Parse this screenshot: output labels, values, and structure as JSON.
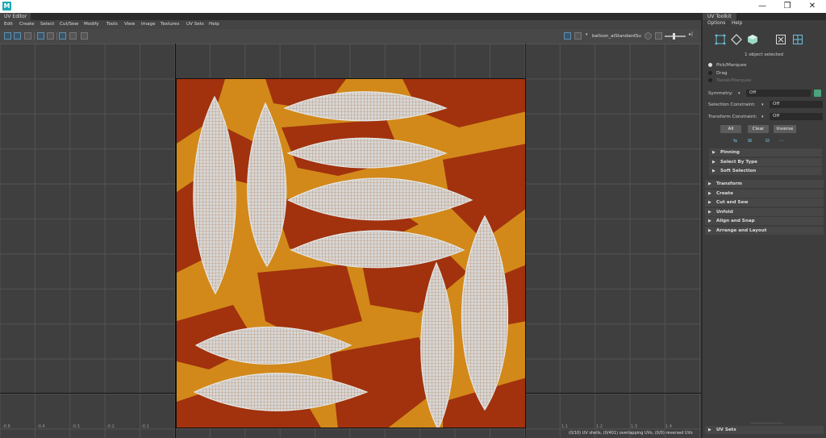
{
  "app": {
    "logo_letter": "M"
  },
  "window_controls": {
    "minimize": "—",
    "restore": "❐",
    "close": "✕"
  },
  "editor": {
    "tab_title": "UV Editor",
    "menus": [
      "Edit",
      "Create",
      "Select",
      "Cut/Sew",
      "Modify",
      "Tools",
      "View",
      "Image",
      "Textures",
      "UV Sets",
      "Help"
    ],
    "texture_name": "balloon_aiStandardSu",
    "axis_labels": [
      "-0.6",
      "-0.4",
      "-0.3",
      "-0.2",
      "-0.1",
      "1.1",
      "1.2",
      "1.3",
      "1.4"
    ],
    "status_text": "(0/10) UV shells, (0/401) overlapping UVs, (0/0) reversed UVs"
  },
  "toolkit": {
    "tab_title": "UV Toolkit",
    "menus": [
      "Options",
      "Help"
    ],
    "selection_count": "1 object selected",
    "selection_modes": [
      {
        "label": "Pick/Marquee",
        "selected": true
      },
      {
        "label": "Drag",
        "selected": false
      },
      {
        "label": "Tweak/Marquee",
        "selected": false
      }
    ],
    "symmetry": {
      "label": "Symmetry:",
      "value": "Off"
    },
    "selection_constraint": {
      "label": "Selection Constraint:",
      "value": "Off"
    },
    "transform_constraint": {
      "label": "Transform Constraint:",
      "value": "Off"
    },
    "buttons": [
      "All",
      "Clear",
      "Inverse"
    ],
    "subsections": [
      "Pinning",
      "Select By Type",
      "Soft Selection"
    ],
    "sections": [
      "Transform",
      "Create",
      "Cut and Sew",
      "Unfold",
      "Align and Snap",
      "Arrange and Layout"
    ],
    "bottom_section": "UV Sets"
  },
  "colors": {
    "texture_orange": "#d2891a",
    "texture_red": "#a1320d",
    "uv_shell": "#d9d9d9",
    "accent_blue": "#5a8fb5"
  }
}
